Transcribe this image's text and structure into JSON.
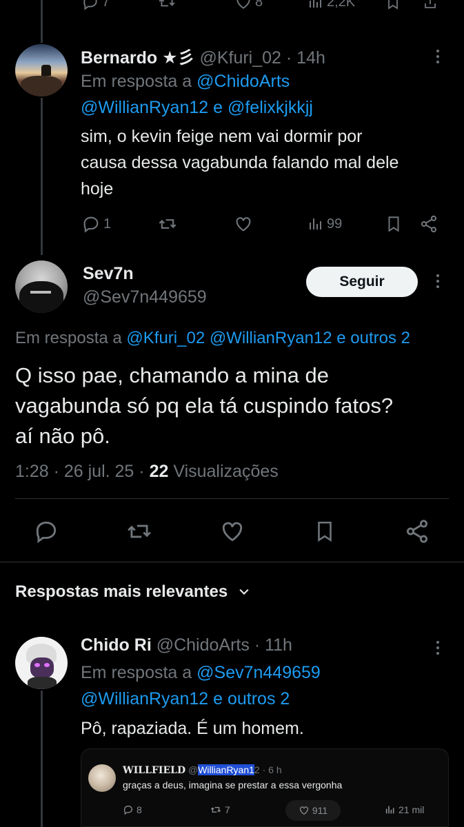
{
  "top_partial": {
    "reply_count": "7",
    "like_count": "8",
    "views": "2,2K"
  },
  "reply1": {
    "name": "Bernardo ★彡",
    "handle": "@Kfuri_02",
    "time": "· 14h",
    "in_reply_to": "Em resposta a",
    "mention1": "@ChidoArts",
    "mention2": "@WillianRyan12",
    "and": "e",
    "mention3": "@felixkjkkjj",
    "text_lines": [
      "sim, o kevin feige nem vai dormir por",
      "causa dessa vagabunda falando mal dele",
      "hoje"
    ],
    "replies": "1",
    "views": "99"
  },
  "main": {
    "name": "Sev7n",
    "handle": "@Sev7n449659",
    "follow_label": "Seguir",
    "in_reply_to": "Em resposta a",
    "mention1": "@Kfuri_02",
    "mention2": "@WillianRyan12",
    "and_others": "e outros 2",
    "text_lines": [
      "Q isso pae, chamando a mina de",
      "vagabunda só pq ela tá cuspindo fatos?",
      "aí não pô."
    ],
    "time": "1:28 · 26 jul. 25 ·",
    "views_count": "22",
    "views_label": "Visualizações"
  },
  "sort": {
    "label": "Respostas mais relevantes"
  },
  "reply2": {
    "name": "Chido Ri",
    "handle": "@ChidoArts",
    "time": "· 11h",
    "in_reply_to": "Em resposta a",
    "mention1": "@Sev7n449659",
    "mention2": "@WillianRyan12",
    "and_others": "e outros 2",
    "text": "Pô, rapaziada. É um homem."
  },
  "embed": {
    "name": "WILLFIELD",
    "handle_prefix": "@",
    "handle_highlight": "WillianRyan1",
    "handle_suffix": "2",
    "time": "· 6 h",
    "text": "graças a deus, imagina se prestar a essa vergonha",
    "replies": "8",
    "reposts": "7",
    "likes": "911",
    "views": "21 mil"
  },
  "colors": {
    "background": "#000000",
    "link": "#1d9bf0",
    "muted": "#71767b",
    "text": "#e7e9ea"
  }
}
